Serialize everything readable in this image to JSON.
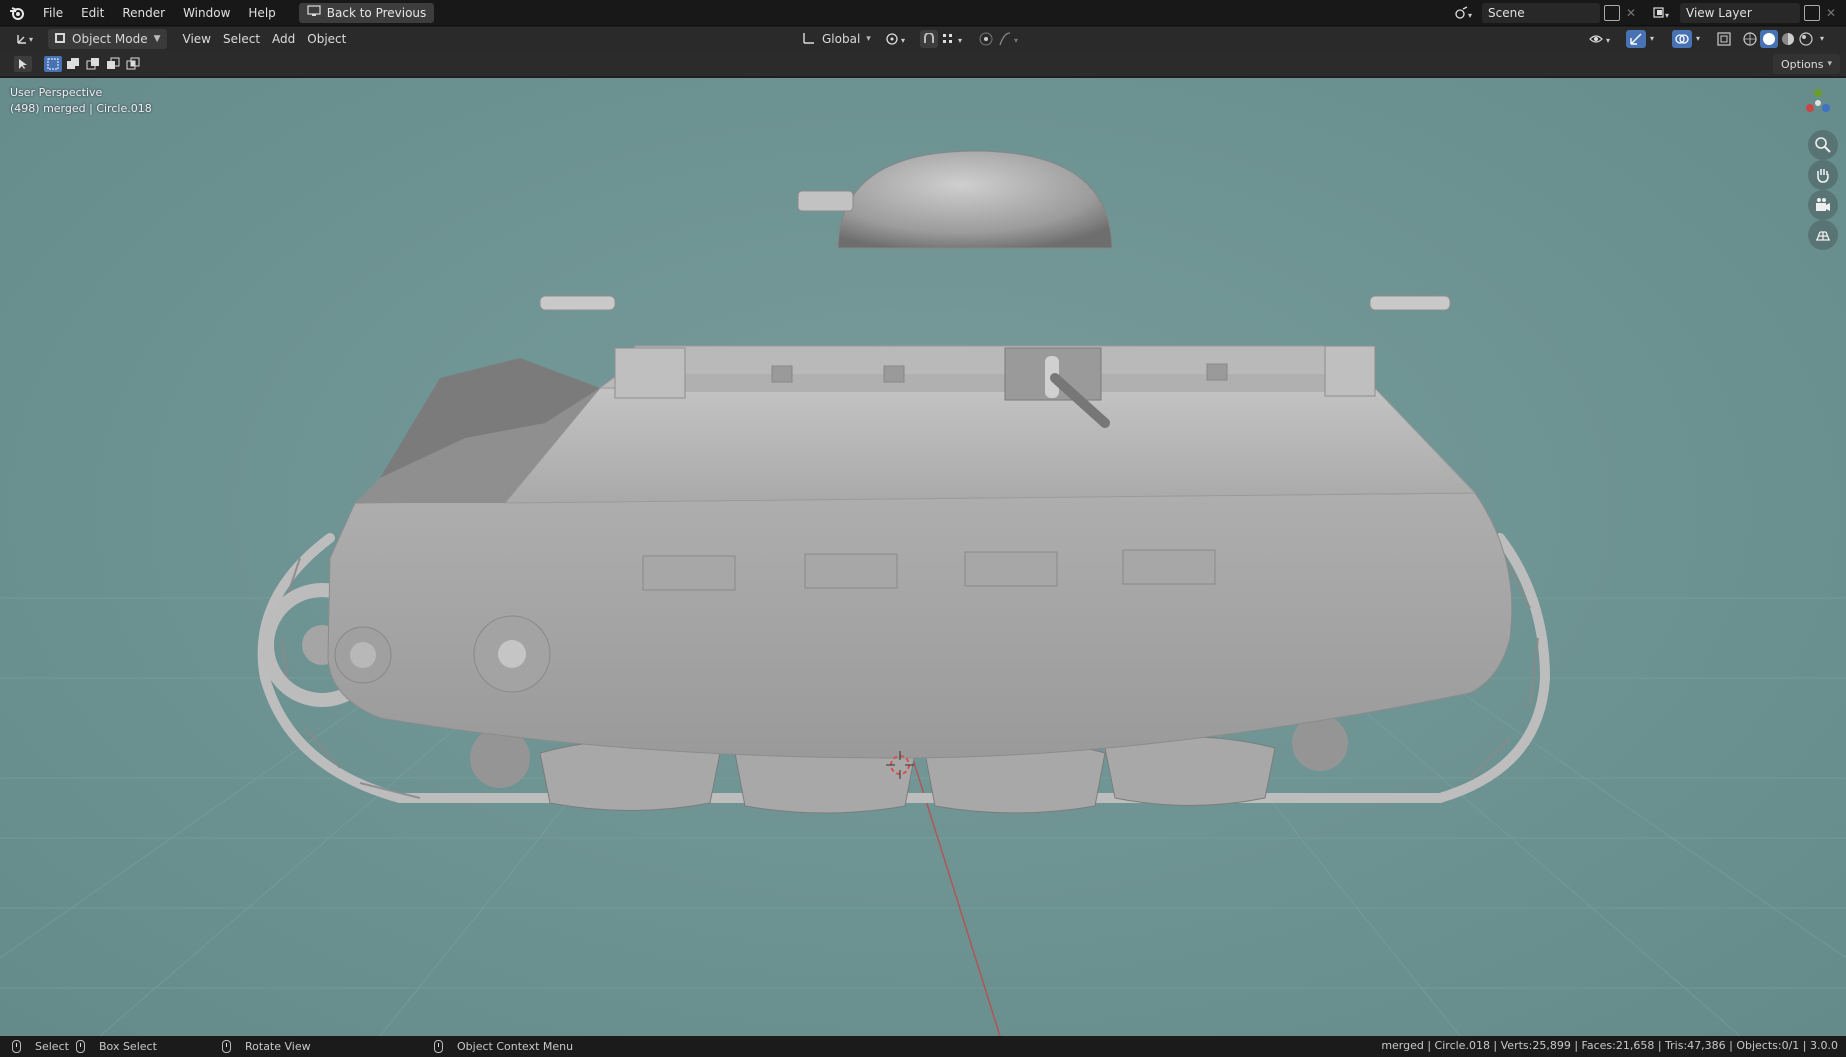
{
  "topbar": {
    "menu": [
      "File",
      "Edit",
      "Render",
      "Window",
      "Help"
    ],
    "back_button": "Back to Previous",
    "scene": "Scene",
    "view_layer": "View Layer"
  },
  "header": {
    "mode": "Object Mode",
    "menu": [
      "View",
      "Select",
      "Add",
      "Object"
    ],
    "transform_orientation": "Global"
  },
  "toolrow": {
    "options": "Options"
  },
  "viewport": {
    "perspective": "User Perspective",
    "object_info": "(498) merged | Circle.018",
    "background_color": "#6f9494"
  },
  "statusbar": {
    "select": "Select",
    "box_select": "Box Select",
    "rotate_view": "Rotate View",
    "context_menu": "Object Context Menu",
    "stats": "merged | Circle.018 | Verts:25,899 | Faces:21,658 | Tris:47,386 | Objects:0/1 | 3.0.0"
  },
  "icons": {
    "logo": "blender-logo-icon",
    "zoom": "zoom-icon",
    "pan": "hand-icon",
    "camera": "camera-icon",
    "grid": "grid-icon"
  }
}
